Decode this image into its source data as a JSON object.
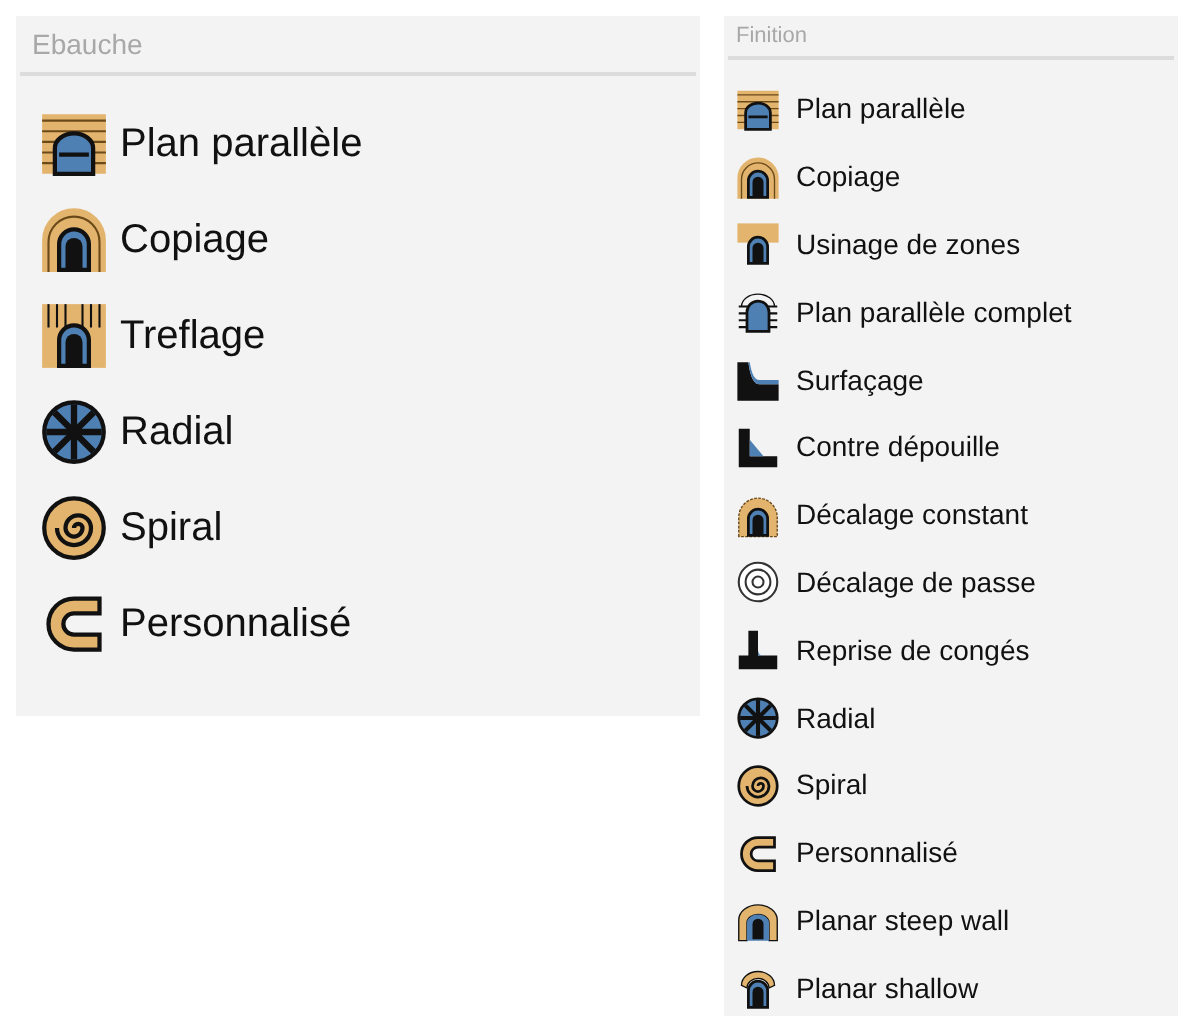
{
  "panels": [
    {
      "title": "Ebauche",
      "kind": "large",
      "items": [
        {
          "label": "Plan parallèle",
          "kind": "parallel"
        },
        {
          "label": "Copiage",
          "kind": "copy"
        },
        {
          "label": "Treflage",
          "kind": "plunge"
        },
        {
          "label": "Radial",
          "kind": "radial"
        },
        {
          "label": "Spiral",
          "kind": "spiral"
        },
        {
          "label": "Personnalisé",
          "kind": "custom"
        }
      ]
    },
    {
      "title": "Finition",
      "kind": "small",
      "items": [
        {
          "label": "Plan parallèle",
          "kind": "parallel"
        },
        {
          "label": "Copiage",
          "kind": "copy"
        },
        {
          "label": "Usinage de zones",
          "kind": "zones"
        },
        {
          "label": "Plan parallèle complet",
          "kind": "parallel-full"
        },
        {
          "label": "Surfaçage",
          "kind": "facing"
        },
        {
          "label": "Contre dépouille",
          "kind": "undercut"
        },
        {
          "label": "Décalage constant",
          "kind": "offset"
        },
        {
          "label": "Décalage de passe",
          "kind": "pass-offset"
        },
        {
          "label": "Reprise de congés",
          "kind": "fillet"
        },
        {
          "label": "Radial",
          "kind": "radial"
        },
        {
          "label": "Spiral",
          "kind": "spiral"
        },
        {
          "label": "Personnalisé",
          "kind": "custom"
        },
        {
          "label": "Planar steep wall",
          "kind": "steep"
        },
        {
          "label": "Planar shallow",
          "kind": "shallow"
        }
      ]
    }
  ]
}
